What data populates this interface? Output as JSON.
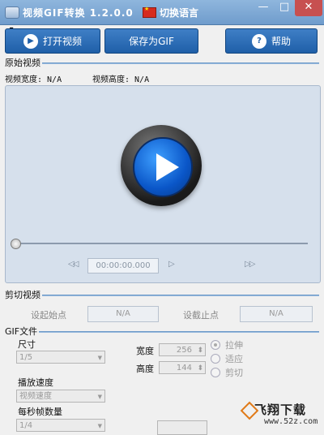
{
  "titlebar": {
    "title": "视频GIF转换 1.2.0.0",
    "language_label": "切换语言",
    "minimize": "—",
    "maximize": "□",
    "close": "✕"
  },
  "toolbar": {
    "open_label": "打开视频",
    "save_label": "保存为GIF",
    "help_label": "帮助",
    "open_icon": "play-circle-icon",
    "help_icon": "question-icon"
  },
  "source_section": {
    "title": "原始视频",
    "width_text": "视频宽度: N/A",
    "height_text": "视频高度: N/A"
  },
  "player": {
    "time": "00:00:00.000",
    "prev_icon": "◁◁",
    "play_icon": "▷",
    "next_icon": "▷▷",
    "seek_position": 0
  },
  "cut_section": {
    "title": "剪切视频",
    "start_label": "设起始点",
    "start_value": "N/A",
    "end_label": "设截止点",
    "end_value": "N/A"
  },
  "gif_section": {
    "title": "GIF文件",
    "size_label": "尺寸",
    "size_value": "1/5",
    "speed_label": "播放速度",
    "speed_value": "视频速度",
    "fps_label": "每秒帧数量",
    "fps_value": "1/4",
    "width_label": "宽度",
    "width_value": "256",
    "height_label": "高度",
    "height_value": "144",
    "options": [
      {
        "label": "拉伸",
        "selected": true
      },
      {
        "label": "适应",
        "selected": false
      },
      {
        "label": "剪切",
        "selected": false
      }
    ]
  },
  "watermark": {
    "text": "飞翔下载",
    "url": "www.52z.com"
  },
  "colors": {
    "titlebar": "#7ea9d6",
    "button": "#1f5fa8",
    "play_blue": "#1a6fe0"
  }
}
